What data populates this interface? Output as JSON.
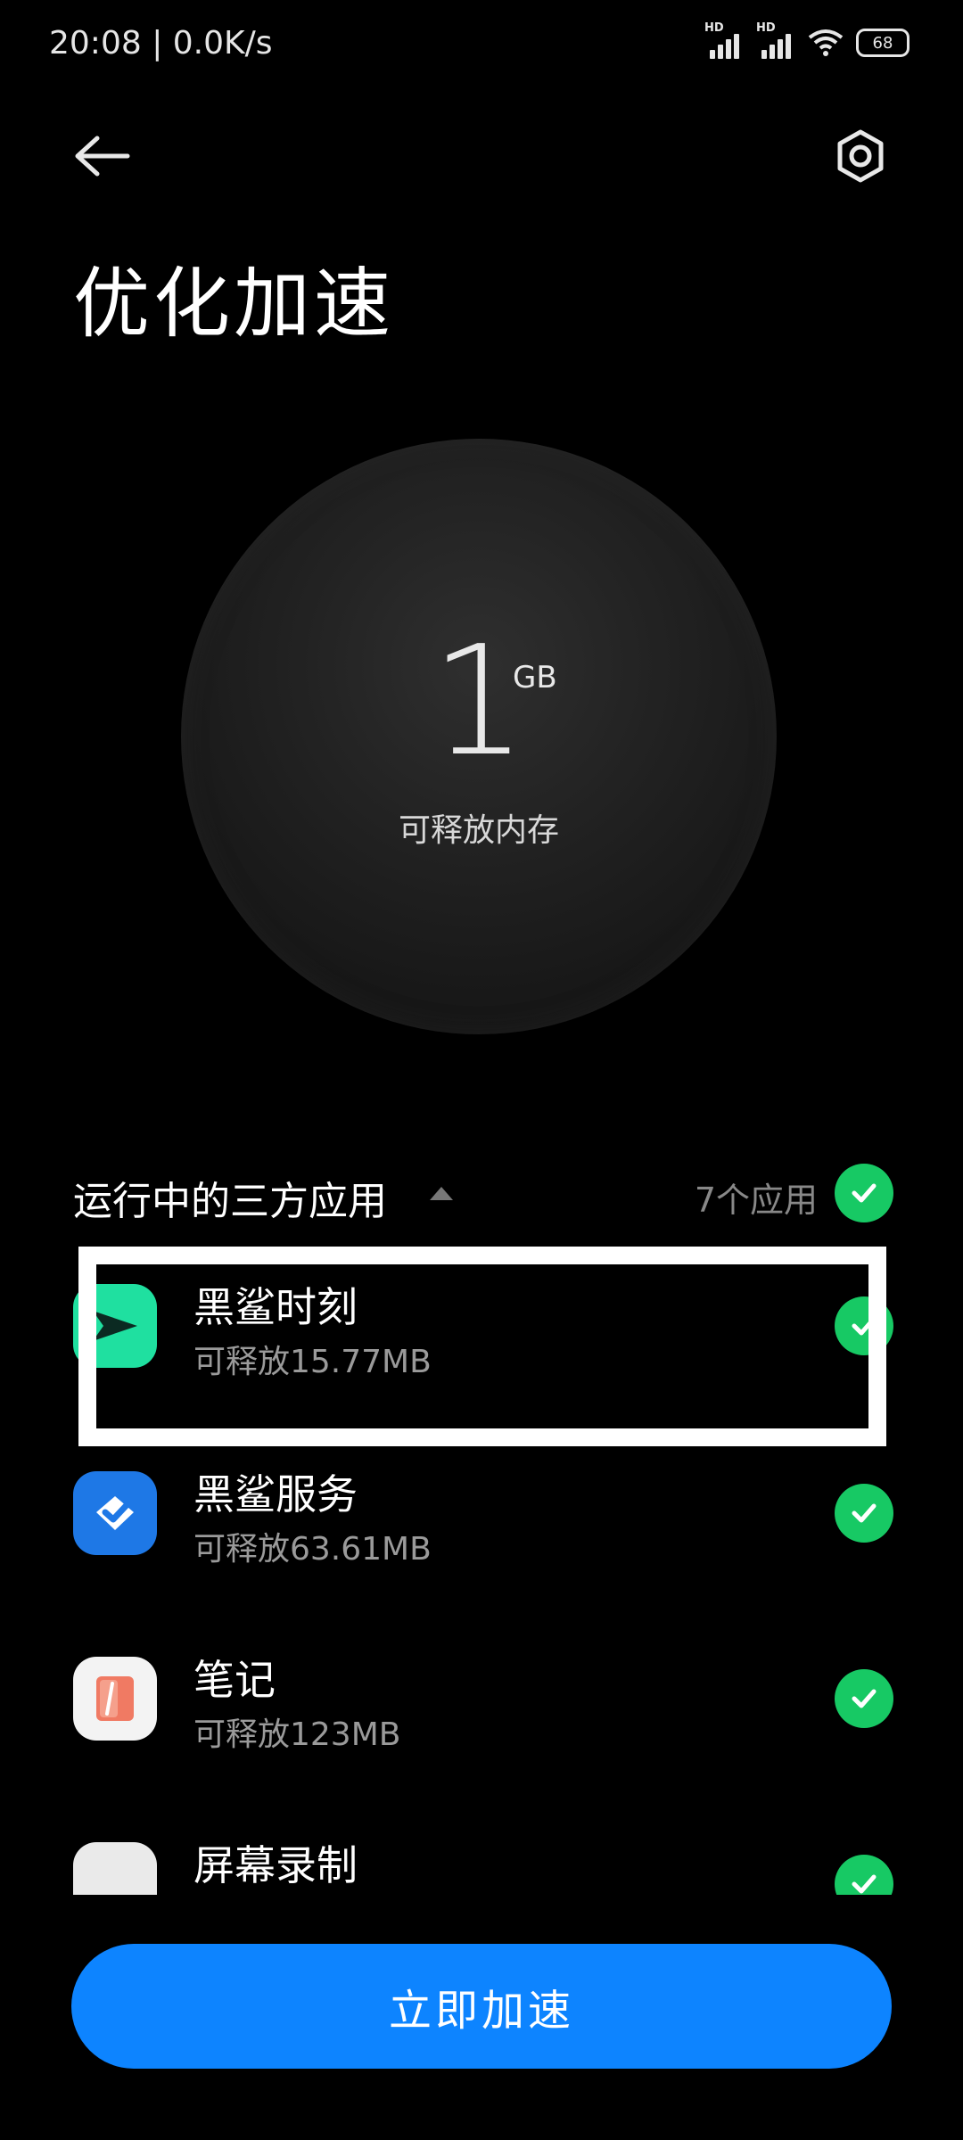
{
  "status_bar": {
    "time": "20:08 | 0.0K/s",
    "signal_label": "HD",
    "battery": "68"
  },
  "header": {
    "title": "优化加速"
  },
  "memory": {
    "value": "1",
    "unit": "GB",
    "label": "可释放内存"
  },
  "section": {
    "title": "运行中的三方应用",
    "count": "7个应用"
  },
  "apps": [
    {
      "name": "黑鲨时刻",
      "size": "可释放15.77MB"
    },
    {
      "name": "黑鲨服务",
      "size": "可释放63.61MB"
    },
    {
      "name": "笔记",
      "size": "可释放123MB"
    },
    {
      "name": "屏幕录制",
      "size": ""
    }
  ],
  "colors": {
    "accent": "#0d84ff",
    "check": "#17c964",
    "background": "#000000"
  },
  "action": {
    "button_label": "立即加速"
  }
}
